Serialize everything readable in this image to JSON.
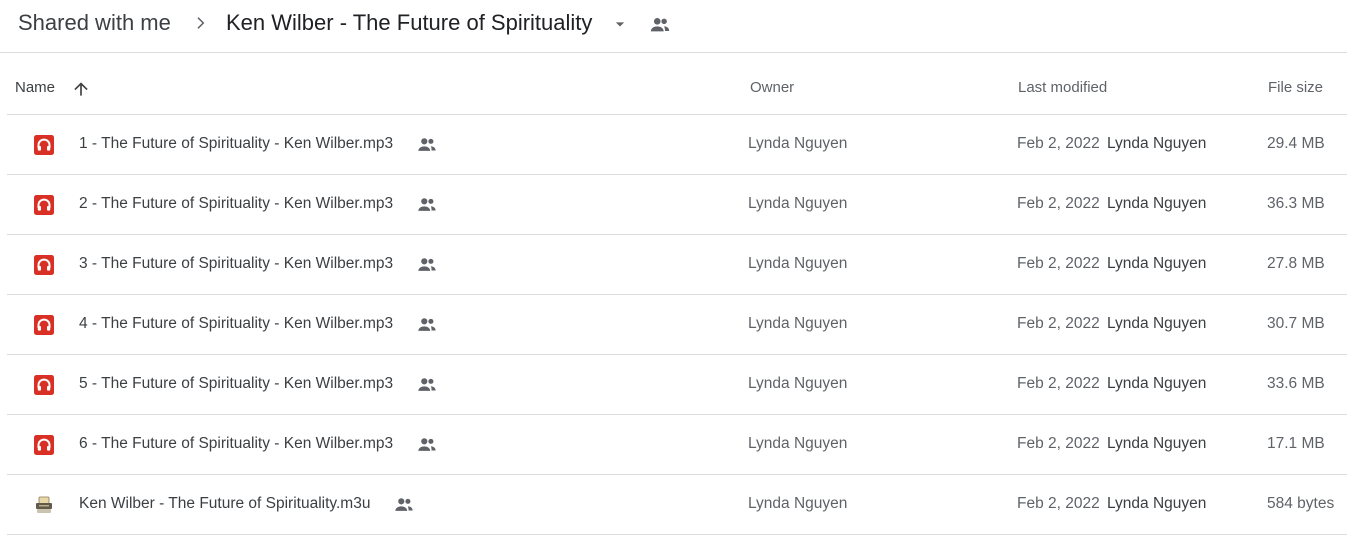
{
  "breadcrumb": {
    "root": "Shared with me",
    "current": "Ken Wilber - The Future of Spirituality"
  },
  "columns": {
    "name": "Name",
    "owner": "Owner",
    "last_modified": "Last modified",
    "file_size": "File size"
  },
  "files": [
    {
      "name": "1 - The Future of Spirituality - Ken Wilber.mp3",
      "icon": "audio-file-icon",
      "owner": "Lynda Nguyen",
      "date": "Feb 2, 2022",
      "modified_by": "Lynda Nguyen",
      "size": "29.4 MB"
    },
    {
      "name": "2 - The Future of Spirituality - Ken Wilber.mp3",
      "icon": "audio-file-icon",
      "owner": "Lynda Nguyen",
      "date": "Feb 2, 2022",
      "modified_by": "Lynda Nguyen",
      "size": "36.3 MB"
    },
    {
      "name": "3 - The Future of Spirituality - Ken Wilber.mp3",
      "icon": "audio-file-icon",
      "owner": "Lynda Nguyen",
      "date": "Feb 2, 2022",
      "modified_by": "Lynda Nguyen",
      "size": "27.8 MB"
    },
    {
      "name": "4 - The Future of Spirituality - Ken Wilber.mp3",
      "icon": "audio-file-icon",
      "owner": "Lynda Nguyen",
      "date": "Feb 2, 2022",
      "modified_by": "Lynda Nguyen",
      "size": "30.7 MB"
    },
    {
      "name": "5 - The Future of Spirituality - Ken Wilber.mp3",
      "icon": "audio-file-icon",
      "owner": "Lynda Nguyen",
      "date": "Feb 2, 2022",
      "modified_by": "Lynda Nguyen",
      "size": "33.6 MB"
    },
    {
      "name": "6 - The Future of Spirituality - Ken Wilber.mp3",
      "icon": "audio-file-icon",
      "owner": "Lynda Nguyen",
      "date": "Feb 2, 2022",
      "modified_by": "Lynda Nguyen",
      "size": "17.1 MB"
    },
    {
      "name": "Ken Wilber - The Future of Spirituality.m3u",
      "icon": "generic-file-icon",
      "owner": "Lynda Nguyen",
      "date": "Feb 2, 2022",
      "modified_by": "Lynda Nguyen",
      "size": "584 bytes"
    }
  ],
  "colors": {
    "audio_icon": "#d93025",
    "divider": "#dadce0",
    "primary_text": "#3c4043",
    "secondary_text": "#5f6368"
  }
}
